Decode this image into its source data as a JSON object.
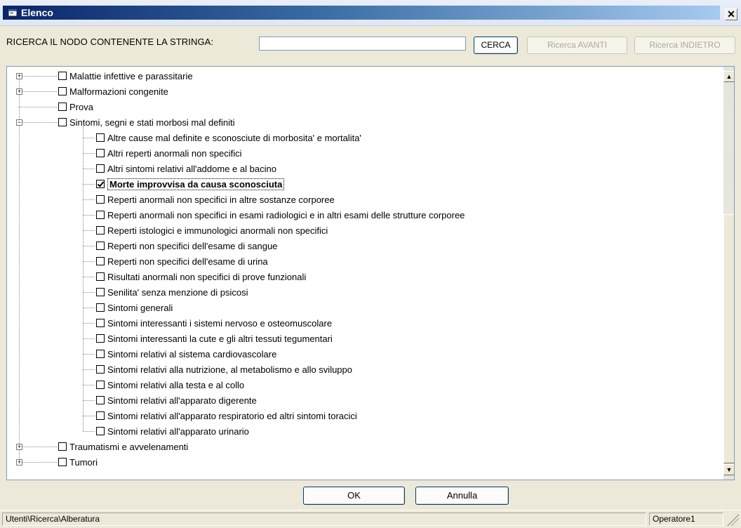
{
  "window": {
    "title": "Elenco",
    "close_glyph": "✕"
  },
  "search": {
    "label": "RICERCA IL NODO CONTENENTE LA STRINGA:",
    "value": "",
    "placeholder": "",
    "find_button": "CERCA",
    "next_button": "Ricerca AVANTI",
    "prev_button": "Ricerca INDIETRO"
  },
  "tree": {
    "top_nodes_before": [
      {
        "label": "Malattie infettive e parassitarie",
        "expander": "+"
      },
      {
        "label": "Malformazioni congenite",
        "expander": "+"
      },
      {
        "label": "Prova",
        "expander": ""
      }
    ],
    "expanded_node": {
      "label": "Sintomi, segni e stati morbosi mal definiti",
      "expander": "−"
    },
    "children": [
      {
        "label": "Altre cause mal definite e sconosciute di morbosita' e mortalita'",
        "checked": false
      },
      {
        "label": "Altri reperti anormali non specifici",
        "checked": false
      },
      {
        "label": "Altri sintomi relativi all'addome e al bacino",
        "checked": false
      },
      {
        "label": "Morte improvvisa da causa sconosciuta",
        "checked": true,
        "selected": true
      },
      {
        "label": "Reperti anormali non specifici in altre sostanze corporee",
        "checked": false
      },
      {
        "label": "Reperti anormali non specifici in esami radiologici e in altri esami delle strutture corporee",
        "checked": false
      },
      {
        "label": "Reperti istologici e immunologici anormali non specifici",
        "checked": false
      },
      {
        "label": "Reperti non specifici dell'esame di sangue",
        "checked": false
      },
      {
        "label": "Reperti non specifici dell'esame di urina",
        "checked": false
      },
      {
        "label": "Risultati anormali non specifici di prove funzionali",
        "checked": false
      },
      {
        "label": "Senilita' senza menzione di psicosi",
        "checked": false
      },
      {
        "label": "Sintomi generali",
        "checked": false
      },
      {
        "label": "Sintomi interessanti i sistemi nervoso e osteomuscolare",
        "checked": false
      },
      {
        "label": "Sintomi interessanti la cute e gli altri tessuti tegumentari",
        "checked": false
      },
      {
        "label": "Sintomi relativi al sistema cardiovascolare",
        "checked": false
      },
      {
        "label": "Sintomi relativi alla nutrizione, al metabolismo e allo sviluppo",
        "checked": false
      },
      {
        "label": "Sintomi relativi alla testa e al collo",
        "checked": false
      },
      {
        "label": "Sintomi relativi all'apparato digerente",
        "checked": false
      },
      {
        "label": "Sintomi relativi all'apparato respiratorio ed altri sintomi toracici",
        "checked": false
      },
      {
        "label": "Sintomi relativi all'apparato urinario",
        "checked": false
      }
    ],
    "top_nodes_after": [
      {
        "label": "Traumatismi e avvelenamenti",
        "expander": "+"
      },
      {
        "label": "Tumori",
        "expander": "+"
      }
    ]
  },
  "scroll": {
    "up_icon": "▲",
    "down_icon": "▼"
  },
  "dialog_buttons": {
    "ok": "OK",
    "cancel": "Annulla"
  },
  "statusbar": {
    "path": "Utenti\\Ricerca\\Alberatura",
    "user": "Operatore1"
  }
}
